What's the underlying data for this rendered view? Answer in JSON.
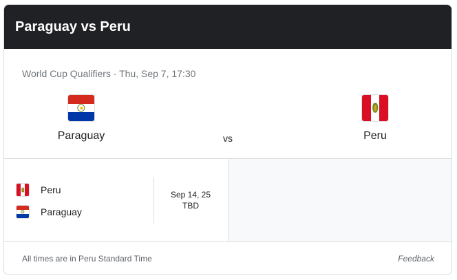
{
  "header": {
    "title": "Paraguay vs Peru"
  },
  "match": {
    "info": "World Cup Qualifiers · Thu, Sep 7, 17:30",
    "home_team": {
      "name": "Paraguay",
      "flag_icon": "paraguay-flag-icon"
    },
    "away_team": {
      "name": "Peru",
      "flag_icon": "peru-flag-icon"
    },
    "vs_label": "vs"
  },
  "fixtures": [
    {
      "team_a": "Peru",
      "team_b": "Paraguay",
      "date": "Sep 14, 25",
      "time": "TBD"
    }
  ],
  "footer": {
    "note": "All times are in Peru Standard Time",
    "feedback_label": "Feedback"
  },
  "colors": {
    "header_bg": "#202124",
    "paraguay_red": "#d52b1e",
    "paraguay_blue": "#0038a8",
    "peru_red": "#d91023"
  }
}
